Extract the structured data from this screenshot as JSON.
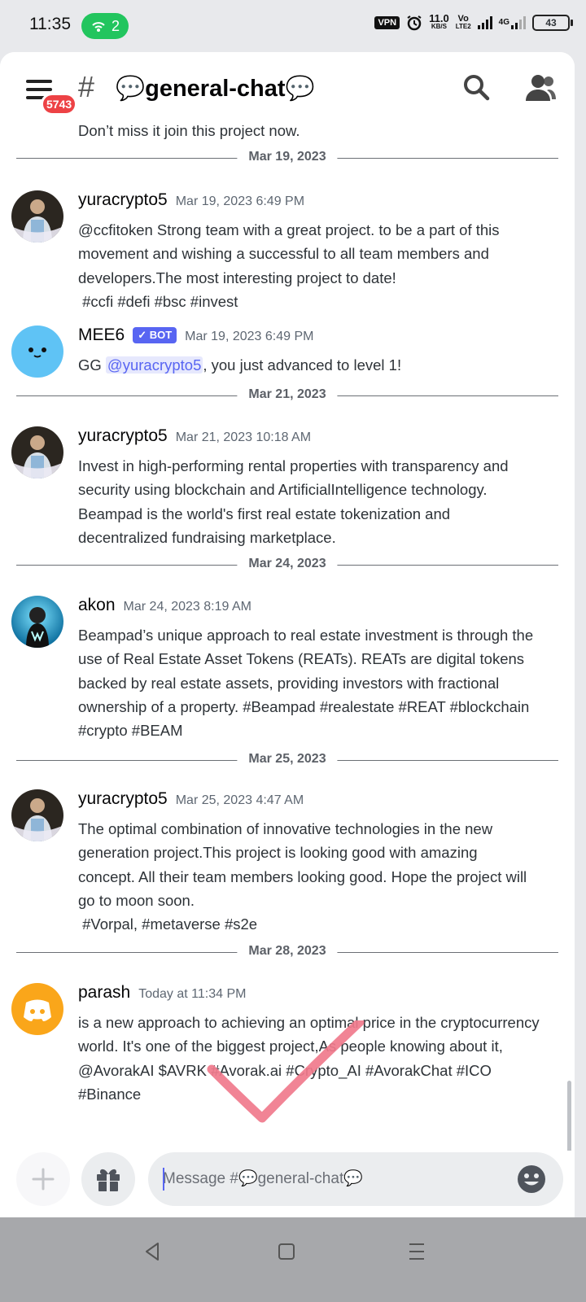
{
  "status_bar": {
    "time": "11:35",
    "hotspot_count": "2",
    "vpn": "VPN",
    "speed_value": "11.0",
    "speed_unit": "KB/S",
    "volte_top": "Vo",
    "volte_bottom": "LTE2",
    "network": "4G",
    "battery": "43"
  },
  "header": {
    "notification_badge": "5743",
    "hash": "#",
    "channel_name": "💬general-chat💬"
  },
  "clipped_message": "Don’t miss it join this project now.",
  "dividers": [
    "Mar 19, 2023",
    "Mar 21, 2023",
    "Mar 24, 2023",
    "Mar 25, 2023",
    "Mar 28, 2023"
  ],
  "messages": [
    {
      "author": "yuracrypto5",
      "time": "Mar 19, 2023 6:49 PM",
      "lines": [
        "@ccfitoken  Strong team with a great project. to be a part of this",
        "movement and wishing a successful to all team members and",
        "developers.The most interesting project to date!",
        " #ccfi #defi #bsc #invest"
      ]
    },
    {
      "author": "MEE6",
      "bot_tag": "✓ BOT",
      "time": "Mar 19, 2023 6:49 PM",
      "prefix": "GG ",
      "mention": "@yuracrypto5",
      "suffix": ", you just advanced to level 1!"
    },
    {
      "author": "yuracrypto5",
      "time": "Mar 21, 2023 10:18 AM",
      "lines": [
        "Invest in high-performing rental properties with transparency and",
        "security using blockchain and ArtificialIntelligence technology.",
        "Beampad is the world's first real estate tokenization and",
        "decentralized fundraising marketplace."
      ]
    },
    {
      "author": "akon",
      "time": "Mar 24, 2023 8:19 AM",
      "lines": [
        "Beampad’s unique approach to real estate investment is through the",
        "use of Real Estate Asset Tokens (REATs). REATs are digital tokens",
        "backed by real estate assets, providing investors with fractional",
        "ownership of a property. #Beampad #realestate #REAT #blockchain",
        "#crypto #BEAM"
      ]
    },
    {
      "author": "yuracrypto5",
      "time": "Mar 25, 2023 4:47 AM",
      "lines": [
        "The optimal combination of innovative technologies in the new",
        "generation project.This project is looking good with amazing",
        "concept. All their team members looking good. Hope the project will",
        "go to moon soon.",
        " #Vorpal, #metaverse #s2e"
      ]
    },
    {
      "author": "parash",
      "time": "Today at 11:34 PM",
      "lines": [
        "is a new approach to achieving an optimal price in the cryptocurrency",
        "world. It's one of the biggest project,As people knowing about it,",
        "@AvorakAI $AVRK #Avorak.ai #Crypto_AI #AvorakChat #ICO",
        "#Binance"
      ]
    }
  ],
  "composer": {
    "placeholder": "Message #💬general-chat💬"
  },
  "colors": {
    "blurple": "#5865f2",
    "mee6_avatar": "#5fc3f5",
    "parash_avatar": "#faa61a",
    "badge_red": "#ed4245",
    "checkmark_pink": "#f07a8c"
  }
}
